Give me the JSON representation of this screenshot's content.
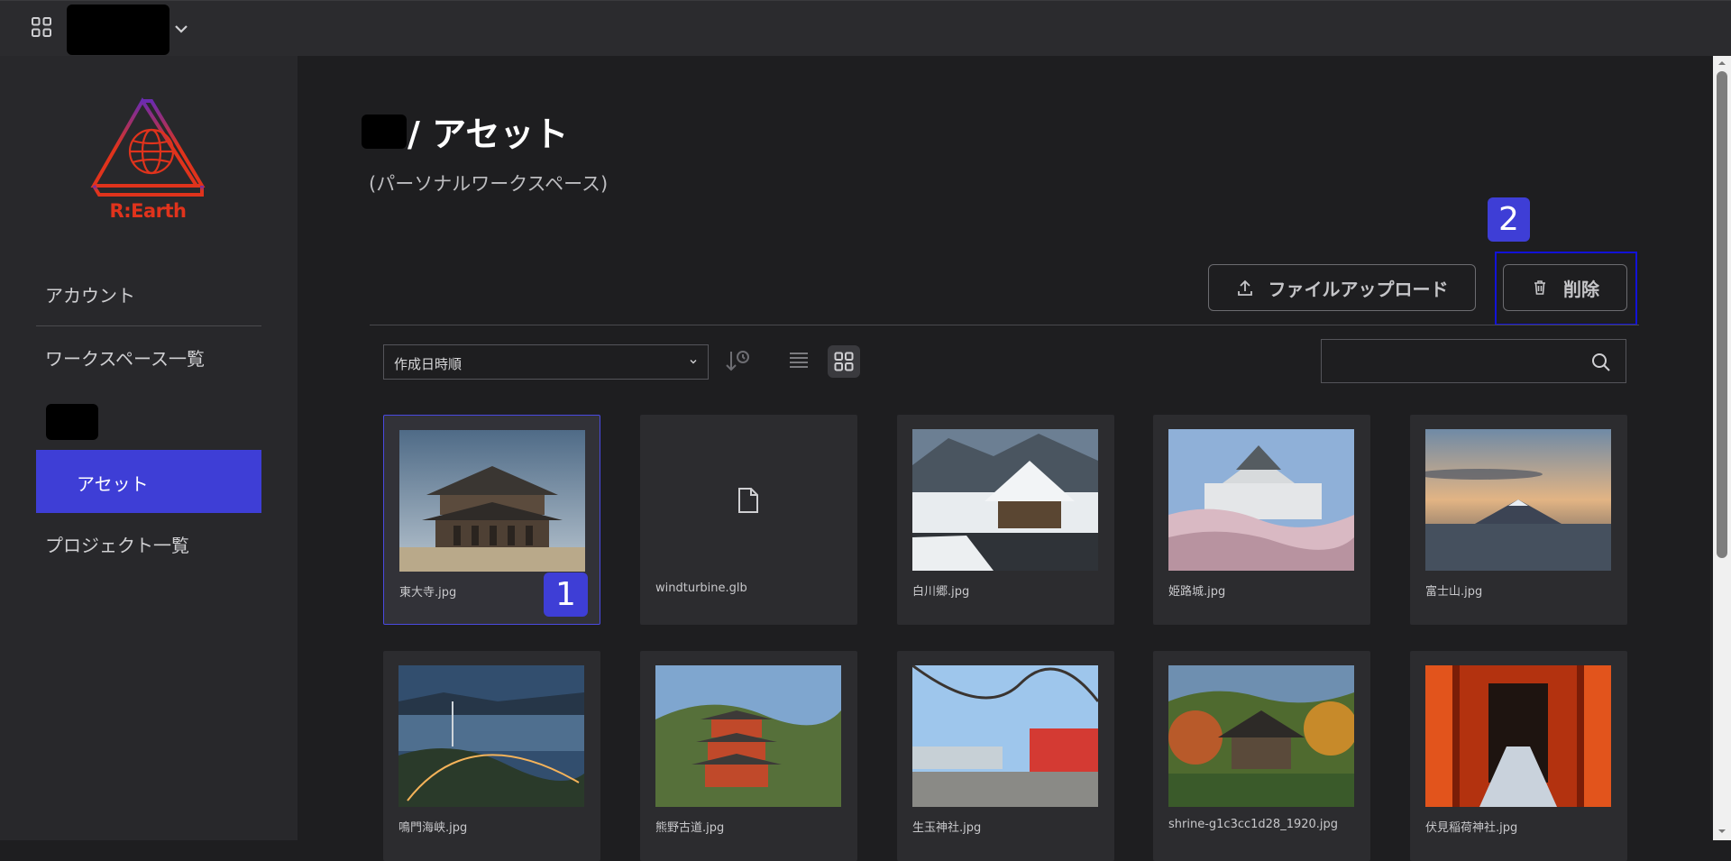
{
  "header": {
    "apps_icon": "grid-apps-icon",
    "workspace_icon": "chevron-down-icon"
  },
  "sidebar": {
    "logo_text": "R:Earth",
    "items": [
      {
        "label": "アカウント"
      },
      {
        "label": "ワークスペース一覧"
      },
      {
        "label": "アセット",
        "active": true
      },
      {
        "label": "プロジェクト一覧"
      }
    ],
    "active_color": "#3e3ed6"
  },
  "page": {
    "title": "/ アセット",
    "subtitle": "(パーソナルワークスペース)"
  },
  "annotations": {
    "badge1": "1",
    "badge2": "2"
  },
  "toolbar": {
    "upload_label": "ファイルアップロード",
    "delete_label": "削除",
    "sort_value": "作成日時順",
    "search_placeholder": ""
  },
  "assets": [
    {
      "name": "東大寺.jpg",
      "selected": true
    },
    {
      "name": "windturbine.glb"
    },
    {
      "name": "白川郷.jpg"
    },
    {
      "name": "姫路城.jpg"
    },
    {
      "name": "富士山.jpg"
    },
    {
      "name": "鳴門海峡.jpg"
    },
    {
      "name": "熊野古道.jpg"
    },
    {
      "name": "生玉神社.jpg"
    },
    {
      "name": "shrine-g1c3cc1d28_1920.jpg"
    },
    {
      "name": "伏見稲荷神社.jpg"
    }
  ]
}
